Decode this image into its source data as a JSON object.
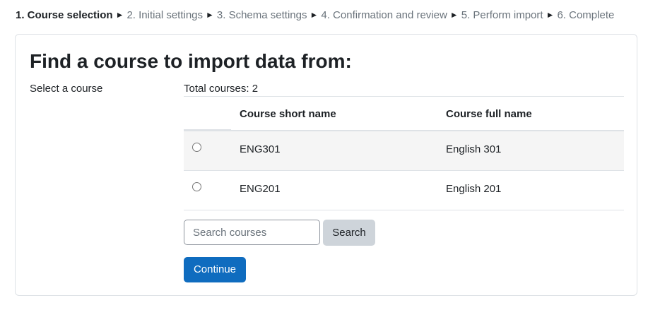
{
  "steps": [
    {
      "label": "1. Course selection",
      "current": true
    },
    {
      "label": "2. Initial settings",
      "current": false
    },
    {
      "label": "3. Schema settings",
      "current": false
    },
    {
      "label": "4. Confirmation and review",
      "current": false
    },
    {
      "label": "5. Perform import",
      "current": false
    },
    {
      "label": "6. Complete",
      "current": false
    }
  ],
  "step_separator": "►",
  "page_title": "Find a course to import data from:",
  "field_label": "Select a course",
  "total_courses": "Total courses: 2",
  "table": {
    "headers": {
      "short_name": "Course short name",
      "full_name": "Course full name"
    },
    "rows": [
      {
        "short_name": "ENG301",
        "full_name": "English 301",
        "selected": false
      },
      {
        "short_name": "ENG201",
        "full_name": "English 201",
        "selected": false
      }
    ]
  },
  "search": {
    "placeholder": "Search courses",
    "value": "",
    "button_label": "Search"
  },
  "continue_label": "Continue",
  "colors": {
    "primary": "#0f6cbf",
    "secondary_button": "#ced4da",
    "stripe": "#f5f5f5",
    "border": "#dee2e6"
  }
}
